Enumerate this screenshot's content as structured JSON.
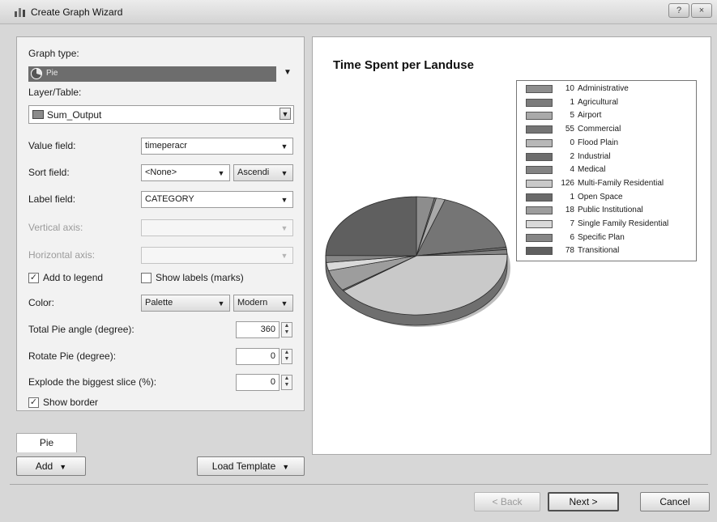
{
  "window": {
    "title": "Create Graph Wizard",
    "controls": [
      "?",
      "×"
    ]
  },
  "settings": {
    "graph_type_label": "Graph type:",
    "graph_type_value": "Pie",
    "layer_label": "Layer/Table:",
    "layer_value": "Sum_Output",
    "value_field_label": "Value field:",
    "value_field_value": "timeperacr",
    "sort_field_label": "Sort field:",
    "sort_field_value": "<None>",
    "sort_order_value": "Ascendi",
    "label_field_label": "Label field:",
    "label_field_value": "CATEGORY",
    "vertical_axis_label": "Vertical axis:",
    "vertical_axis_value": "",
    "horizontal_axis_label": "Horizontal axis:",
    "horizontal_axis_value": "",
    "add_to_legend_label": "Add to legend",
    "add_to_legend_checked": true,
    "show_labels_label": "Show labels (marks)",
    "show_labels_checked": false,
    "color_label": "Color:",
    "color_mode_value": "Palette",
    "color_palette_value": "Modern",
    "total_angle_label": "Total Pie angle (degree):",
    "total_angle_value": "360",
    "rotate_label": "Rotate Pie (degree):",
    "rotate_value": "0",
    "explode_label": "Explode the biggest slice (%):",
    "explode_value": "0",
    "show_border_label": "Show border",
    "show_border_checked": true
  },
  "tabs": {
    "pie": "Pie"
  },
  "buttons": {
    "add": "Add",
    "load_template": "Load Template",
    "back": "< Back",
    "next": "Next >",
    "cancel": "Cancel"
  },
  "chart_data": {
    "type": "pie",
    "title": "Time Spent per Landuse",
    "legend_position": "right",
    "categories": [
      "Administrative",
      "Agricultural",
      "Airport",
      "Commercial",
      "Flood Plain",
      "Industrial",
      "Medical",
      "Multi-Family Residential",
      "Open Space",
      "Public Institutional",
      "Single Family Residential",
      "Specific Plan",
      "Transitional"
    ],
    "values": [
      10,
      1,
      5,
      55,
      0,
      2,
      4,
      126,
      1,
      18,
      7,
      6,
      78
    ],
    "labels": [
      "10",
      "1",
      "5",
      "55",
      "0",
      "2",
      "4",
      "126",
      "1",
      "18",
      "7",
      "6",
      "78"
    ],
    "colors": [
      "#8d8d8d",
      "#7c7c7c",
      "#a9a9a9",
      "#757575",
      "#b8b8b8",
      "#6e6e6e",
      "#838383",
      "#c9c9c9",
      "#6a6a6a",
      "#9d9d9d",
      "#d9d9d9",
      "#868686",
      "#5f5f5f"
    ]
  }
}
